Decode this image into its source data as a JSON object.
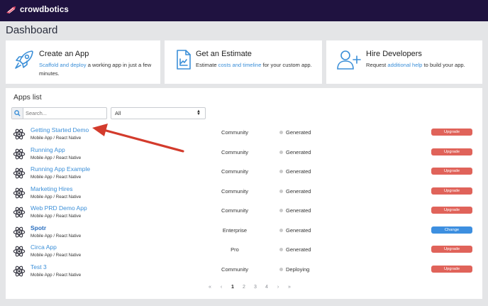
{
  "brand": {
    "name": "crowdbotics",
    "accent": "#e84b6a",
    "topbar_color": "#1f1240"
  },
  "page": {
    "title": "Dashboard"
  },
  "cards": [
    {
      "title": "Create an App",
      "desc_link": "Scaffold and deploy",
      "desc_rest": " a working app in just a few minutes.",
      "icon": "rocket-icon"
    },
    {
      "title": "Get an Estimate",
      "desc_pre": "Estimate ",
      "desc_link": "costs and timeline",
      "desc_rest": " for your custom app.",
      "icon": "estimate-document-icon"
    },
    {
      "title": "Hire Developers",
      "desc_pre": "Request ",
      "desc_link": "additional help",
      "desc_rest": " to build your app.",
      "icon": "add-user-icon"
    }
  ],
  "apps_list": {
    "title": "Apps list",
    "search_placeholder": "Search...",
    "filter_value": "All",
    "apps": [
      {
        "name": "Getting Started Demo",
        "type": "Mobile App / React Native",
        "plan": "Community",
        "status": "Generated",
        "action": "Upgrade"
      },
      {
        "name": "Running App",
        "type": "Mobile App / React Native",
        "plan": "Community",
        "status": "Generated",
        "action": "Upgrade"
      },
      {
        "name": "Running App Example",
        "type": "Mobile App / React Native",
        "plan": "Community",
        "status": "Generated",
        "action": "Upgrade"
      },
      {
        "name": "Marketing Hires",
        "type": "Mobile App / React Native",
        "plan": "Community",
        "status": "Generated",
        "action": "Upgrade"
      },
      {
        "name": "Web PRD Demo App",
        "type": "Mobile App / React Native",
        "plan": "Community",
        "status": "Generated",
        "action": "Upgrade"
      },
      {
        "name": "Spotr",
        "type": "Mobile App / React Native",
        "plan": "Enterprise",
        "status": "Generated",
        "action": "Change"
      },
      {
        "name": "Circa App",
        "type": "Mobile App / React Native",
        "plan": "Pro",
        "status": "Generated",
        "action": "Upgrade"
      },
      {
        "name": "Test 3",
        "type": "Mobile App / React Native",
        "plan": "Community",
        "status": "Deploying",
        "action": "Upgrade"
      }
    ],
    "upgrade_color": "#e0635a",
    "change_color": "#3d8fe0"
  },
  "pagination": {
    "first": "«",
    "prev": "‹",
    "pages": [
      "1",
      "2",
      "3",
      "4"
    ],
    "current": "1",
    "next": "›",
    "last": "»"
  },
  "annotation": {
    "color": "#d33b2c"
  }
}
